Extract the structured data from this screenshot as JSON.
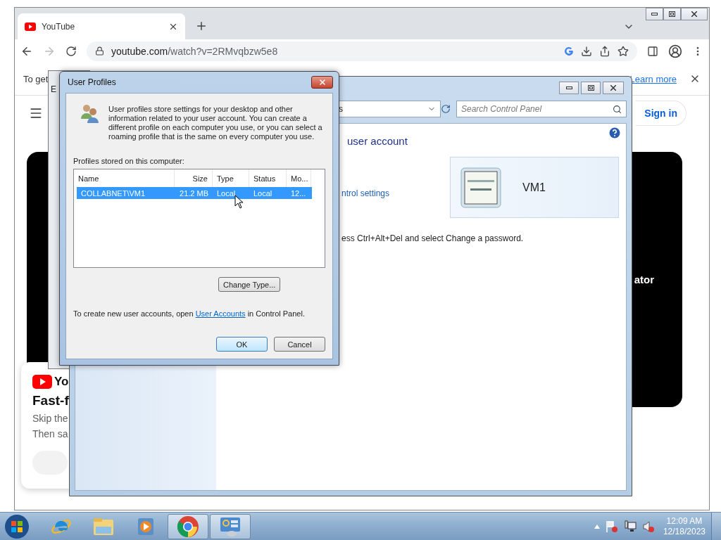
{
  "browser": {
    "tab": {
      "title": "YouTube"
    },
    "url": {
      "host": "youtube.com",
      "path": "/watch?v=2RMvqbzw5e8"
    },
    "forward_disabled": true,
    "infobar": {
      "text": "To get",
      "link": "Learn more"
    },
    "page": {
      "sign_in": "Sign in",
      "video_caption": "ator",
      "promo": {
        "logo_text": "Yo",
        "title": "Fast-f",
        "lines": [
          "Skip the",
          "Then sa"
        ]
      }
    }
  },
  "behind_window": {
    "title": "E"
  },
  "control_panel": {
    "address": "s",
    "search_placeholder": "Search Control Panel",
    "heading": "user account",
    "link": "ntrol settings",
    "account_name": "VM1",
    "note": "ess Ctrl+Alt+Del and select Change a password."
  },
  "dialog": {
    "title": "User Profiles",
    "description": "User profiles store settings for your desktop and other information related to your user account. You can create a different profile on each computer you use, or you can select a roaming profile that is the same on every computer you use.",
    "list_label": "Profiles stored on this computer:",
    "columns": [
      {
        "label": "Name"
      },
      {
        "label": "Size"
      },
      {
        "label": "Type"
      },
      {
        "label": "Status"
      },
      {
        "label": "Mo..."
      }
    ],
    "rows": [
      {
        "cells": [
          "COLLABNET\\VM1",
          "21.2 MB",
          "Local",
          "Local",
          "12..."
        ],
        "selected": true
      }
    ],
    "change_type": "Change Type...",
    "footer": {
      "before": "To create new user accounts, open ",
      "link": "User Accounts",
      "after": " in Control Panel."
    },
    "buttons": [
      {
        "label": "OK",
        "default": true
      },
      {
        "label": "Cancel",
        "default": false
      }
    ]
  },
  "taskbar": {
    "apps": [
      {
        "kind": "ie",
        "running": false
      },
      {
        "kind": "explorer",
        "running": false
      },
      {
        "kind": "media",
        "running": false
      },
      {
        "kind": "chrome",
        "running": true
      },
      {
        "kind": "control",
        "running": true
      }
    ],
    "clock": {
      "time": "12:09 AM",
      "date": "12/18/2023"
    }
  }
}
